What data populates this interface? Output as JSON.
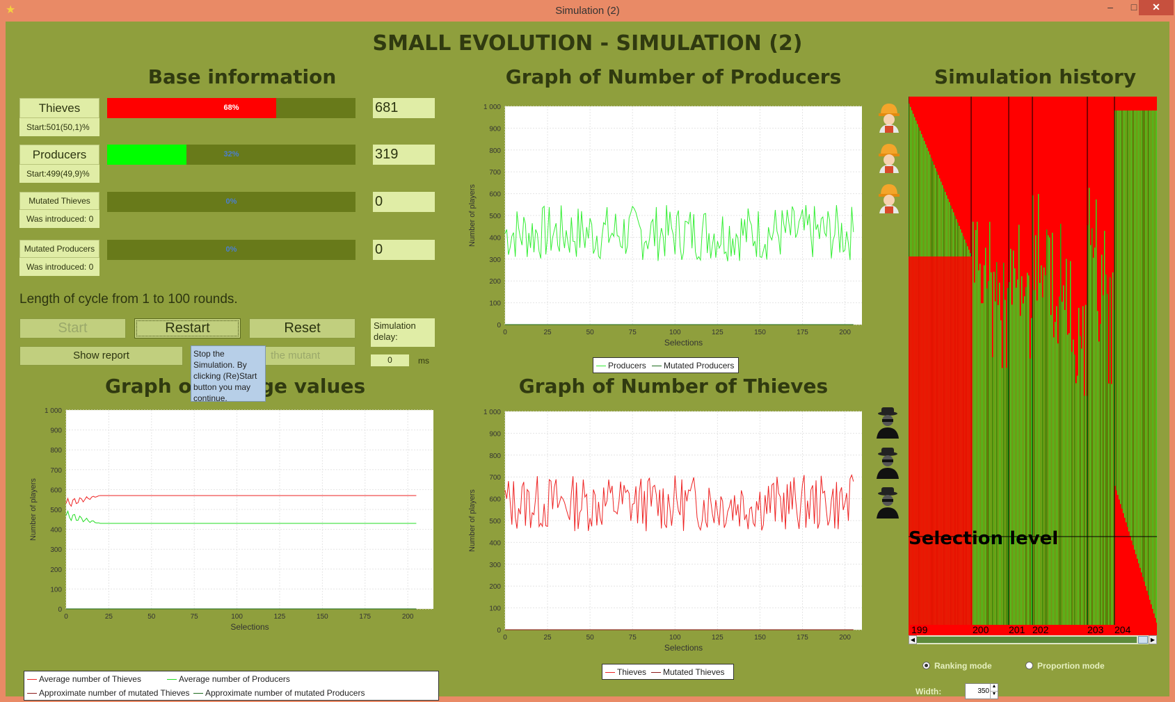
{
  "window": {
    "title": "Simulation (2)",
    "minimize": "–",
    "maximize": "□",
    "close": "✕"
  },
  "heading": "SMALL EVOLUTION - SIMULATION (2)",
  "base_info": {
    "title": "Base information",
    "rows": [
      {
        "label": "Thieves",
        "sub": "Start:501(50,1)%",
        "percent_text": "68%",
        "fraction": 0.68,
        "count": "681",
        "color": "#ff0000"
      },
      {
        "label": "Producers",
        "sub": "Start:499(49,9)%",
        "percent_text": "32%",
        "fraction": 0.32,
        "count": "319",
        "color": "#00ff00"
      },
      {
        "label": "Mutated Thieves",
        "sub": "Was introduced: 0",
        "percent_text": "0%",
        "fraction": 0,
        "count": "0",
        "color": "#ff0000"
      },
      {
        "label": "Mutated Producers",
        "sub": "Was introduced: 0",
        "percent_text": "0%",
        "fraction": 0,
        "count": "0",
        "color": "#00ff00"
      }
    ],
    "cycle_text": "Length of cycle from 1 to 100 rounds."
  },
  "controls": {
    "start": "Start",
    "restart": "Restart",
    "reset": "Reset",
    "show_report": "Show report",
    "introduce_mutant": "the mutant",
    "delay_label": "Simulation delay:",
    "delay_value": "0",
    "delay_unit": "ms"
  },
  "tooltip": "Stop the Simulation. By clicking (Re)Start button you may continue.",
  "charts": {
    "producers": {
      "title": "Graph of Number of Producers",
      "xlabel": "Selections",
      "ylabel": "Number of players",
      "legend": [
        "Producers",
        "Mutated Producers"
      ]
    },
    "thieves": {
      "title": "Graph of Number of Thieves",
      "xlabel": "Selections",
      "ylabel": "Number of players",
      "legend": [
        "Thieves",
        "Mutated Thieves"
      ]
    },
    "average": {
      "title": "Graph of Average values",
      "title_left": "Graph of",
      "title_right": "ge values",
      "xlabel": "Selections",
      "ylabel": "Number of players",
      "legend": [
        "Average number of Thieves",
        "Average number of Producers",
        "Approximate number of mutated Thieves",
        "Approximate number of mutated Producers"
      ]
    }
  },
  "history": {
    "title": "Simulation history",
    "selection_level": "Selection level",
    "markers": [
      "199",
      "200",
      "201",
      "202",
      "203",
      "204"
    ],
    "ranking_mode": "Ranking mode",
    "proportion_mode": "Proportion mode",
    "width_label": "Width:",
    "width_value": "350"
  },
  "chart_data": [
    {
      "type": "line",
      "title": "Graph of Number of Producers",
      "xlabel": "Selections",
      "ylabel": "Number of players",
      "xlim": [
        0,
        210
      ],
      "ylim": [
        0,
        1000
      ],
      "x_ticks": [
        0,
        25,
        50,
        75,
        100,
        125,
        150,
        175,
        200
      ],
      "y_ticks": [
        0,
        100,
        200,
        300,
        400,
        500,
        600,
        700,
        800,
        900,
        1000
      ],
      "y_tick_labels": [
        "0",
        "100",
        "200",
        "300",
        "400",
        "500",
        "600",
        "700",
        "800",
        "900",
        "1 000"
      ],
      "series": [
        {
          "name": "Producers",
          "color": "#33ee33",
          "mean": 420,
          "amplitude": 130,
          "seed": 7,
          "n": 205
        },
        {
          "name": "Mutated Producers",
          "color": "#1d6b1d",
          "constant": 0,
          "n": 205
        }
      ]
    },
    {
      "type": "line",
      "title": "Graph of Number of Thieves",
      "xlabel": "Selections",
      "ylabel": "Number of players",
      "xlim": [
        0,
        210
      ],
      "ylim": [
        0,
        1000
      ],
      "x_ticks": [
        0,
        25,
        50,
        75,
        100,
        125,
        150,
        175,
        200
      ],
      "y_ticks": [
        0,
        100,
        200,
        300,
        400,
        500,
        600,
        700,
        800,
        900,
        1000
      ],
      "y_tick_labels": [
        "0",
        "100",
        "200",
        "300",
        "400",
        "500",
        "600",
        "700",
        "800",
        "900",
        "1 000"
      ],
      "series": [
        {
          "name": "Thieves",
          "color": "#ee2222",
          "mean": 580,
          "amplitude": 130,
          "seed": 13,
          "n": 205
        },
        {
          "name": "Mutated Thieves",
          "color": "#8b1a1a",
          "constant": 0,
          "n": 205
        }
      ]
    },
    {
      "type": "line",
      "title": "Graph of Average values",
      "xlabel": "Selections",
      "ylabel": "Number of players",
      "xlim": [
        0,
        215
      ],
      "ylim": [
        0,
        1000
      ],
      "x_ticks": [
        0,
        25,
        50,
        75,
        100,
        125,
        150,
        175,
        200
      ],
      "y_ticks": [
        0,
        100,
        200,
        300,
        400,
        500,
        600,
        700,
        800,
        900,
        1000
      ],
      "y_tick_labels": [
        "0",
        "100",
        "200",
        "300",
        "400",
        "500",
        "600",
        "700",
        "800",
        "900",
        "1 000"
      ],
      "series": [
        {
          "name": "Average number of Thieves",
          "color": "#ee2222",
          "start": 530,
          "value": 570,
          "n": 205
        },
        {
          "name": "Average number of Producers",
          "color": "#22dd22",
          "start": 470,
          "value": 430,
          "n": 205
        },
        {
          "name": "Approximate number of mutated Thieves",
          "color": "#8b1a1a",
          "constant": 0,
          "n": 205
        },
        {
          "name": "Approximate number of mutated Producers",
          "color": "#1d6b1d",
          "constant": 0,
          "n": 205
        }
      ]
    }
  ]
}
